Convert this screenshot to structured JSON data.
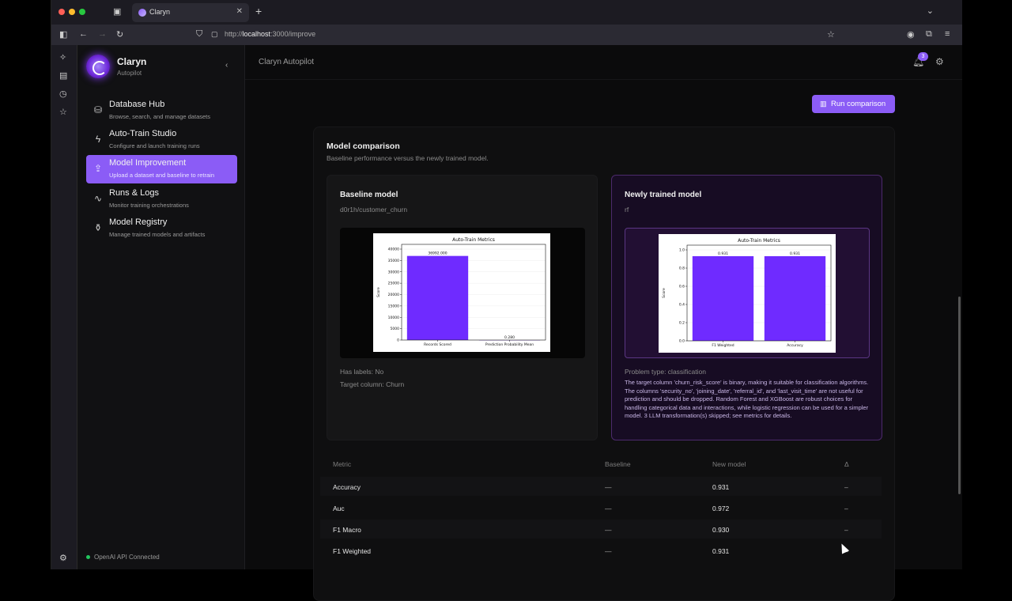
{
  "browser": {
    "tab_title": "Claryn",
    "url_prefix": "http://",
    "url_host": "localhost",
    "url_path": ":3000/improve"
  },
  "sidebar": {
    "brand": "Claryn",
    "brand_sub": "Autopilot",
    "items": [
      {
        "label": "Database Hub",
        "sub": "Browse, search, and manage datasets"
      },
      {
        "label": "Auto-Train Studio",
        "sub": "Configure and launch training runs"
      },
      {
        "label": "Model Improvement",
        "sub": "Upload a dataset and baseline to retrain"
      },
      {
        "label": "Runs & Logs",
        "sub": "Monitor training orchestrations"
      },
      {
        "label": "Model Registry",
        "sub": "Manage trained models and artifacts"
      }
    ],
    "status": "OpenAI API Connected"
  },
  "header": {
    "title": "Claryn Autopilot",
    "notifications": "3"
  },
  "run_button": "Run comparison",
  "comparison": {
    "title": "Model comparison",
    "subtitle": "Baseline performance versus the newly trained model.",
    "baseline": {
      "title": "Baseline model",
      "name": "d0r1h/customer_churn",
      "has_labels": "Has labels: No",
      "target": "Target column: Churn"
    },
    "new_model": {
      "title": "Newly trained model",
      "name": "rf",
      "problem": "Problem type: classification",
      "description": "The target column 'churn_risk_score' is binary, making it suitable for classification algorithms. The columns 'security_no', 'joining_date', 'referral_id', and 'last_visit_time' are not useful for prediction and should be dropped. Random Forest and XGBoost are robust choices for handling categorical data and interactions, while logistic regression can be used for a simpler model. 3 LLM transformation(s) skipped; see metrics for details."
    }
  },
  "chart_data": [
    {
      "type": "bar",
      "title": "Auto-Train Metrics",
      "ylabel": "Score",
      "categories": [
        "Records Scored",
        "Prediction Probability Mean"
      ],
      "values": [
        36992.0,
        0.28
      ],
      "value_labels": [
        "36992.000",
        "0.280"
      ],
      "yticks": [
        "0",
        "5000",
        "10000",
        "15000",
        "20000",
        "25000",
        "30000",
        "35000",
        "40000"
      ],
      "ylim": [
        0,
        40000
      ],
      "color": "#6f2bff"
    },
    {
      "type": "bar",
      "title": "Auto-Train Metrics",
      "ylabel": "Score",
      "categories": [
        "F1 Weighted",
        "Accuracy"
      ],
      "values": [
        0.931,
        0.931
      ],
      "value_labels": [
        "0.931",
        "0.931"
      ],
      "yticks": [
        "0.0",
        "0.2",
        "0.4",
        "0.6",
        "0.8",
        "1.0"
      ],
      "ylim": [
        0,
        1.0
      ],
      "color": "#6f2bff"
    }
  ],
  "table": {
    "headers": [
      "Metric",
      "Baseline",
      "New model",
      "Δ"
    ],
    "rows": [
      {
        "metric": "Accuracy",
        "baseline": "—",
        "new": "0.931",
        "delta": "–"
      },
      {
        "metric": "Auc",
        "baseline": "—",
        "new": "0.972",
        "delta": "–"
      },
      {
        "metric": "F1 Macro",
        "baseline": "—",
        "new": "0.930",
        "delta": "–"
      },
      {
        "metric": "F1 Weighted",
        "baseline": "—",
        "new": "0.931",
        "delta": "–"
      }
    ]
  }
}
